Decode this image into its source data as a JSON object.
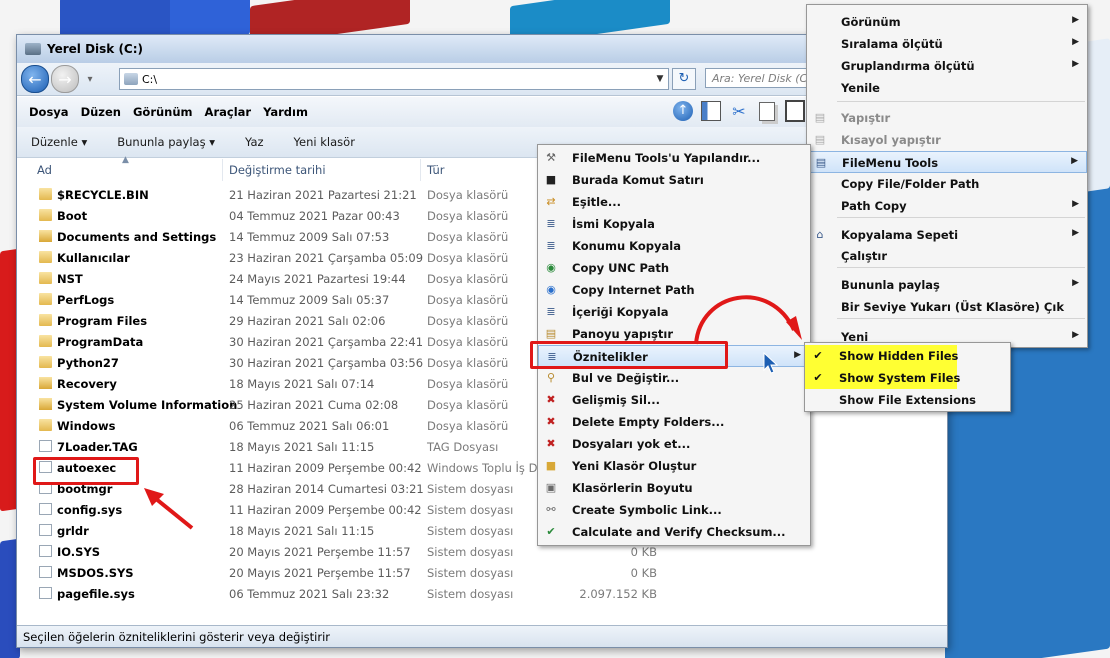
{
  "window": {
    "title": "Yerel Disk (C:)"
  },
  "address": {
    "path": "C:\\",
    "search_placeholder": "Ara: Yerel Disk (C:)"
  },
  "menubar": [
    "Dosya",
    "Düzen",
    "Görünüm",
    "Araçlar",
    "Yardım"
  ],
  "commandbar": [
    "Düzenle ▾",
    "Bununla paylaş ▾",
    "Yaz",
    "Yeni klasör"
  ],
  "columns": {
    "name": "Ad",
    "date": "Değiştirme tarihi",
    "type": "Tür"
  },
  "files": [
    {
      "name": "$RECYCLE.BIN",
      "date": "21 Haziran 2021 Pazartesi 21:21",
      "type": "Dosya klasörü",
      "size": "",
      "kind": "folder"
    },
    {
      "name": "Boot",
      "date": "04 Temmuz 2021 Pazar 00:43",
      "type": "Dosya klasörü",
      "size": "",
      "kind": "folder"
    },
    {
      "name": "Documents and Settings",
      "date": "14 Temmuz 2009 Salı 07:53",
      "type": "Dosya klasörü",
      "size": "",
      "kind": "lock"
    },
    {
      "name": "Kullanıcılar",
      "date": "23 Haziran 2021 Çarşamba 05:09",
      "type": "Dosya klasörü",
      "size": "",
      "kind": "folder"
    },
    {
      "name": "NST",
      "date": "24 Mayıs 2021 Pazartesi 19:44",
      "type": "Dosya klasörü",
      "size": "",
      "kind": "folder"
    },
    {
      "name": "PerfLogs",
      "date": "14 Temmuz 2009 Salı 05:37",
      "type": "Dosya klasörü",
      "size": "",
      "kind": "folder"
    },
    {
      "name": "Program Files",
      "date": "29 Haziran 2021 Salı 02:06",
      "type": "Dosya klasörü",
      "size": "",
      "kind": "folder"
    },
    {
      "name": "ProgramData",
      "date": "30 Haziran 2021 Çarşamba 22:41",
      "type": "Dosya klasörü",
      "size": "",
      "kind": "folder"
    },
    {
      "name": "Python27",
      "date": "30 Haziran 2021 Çarşamba 03:56",
      "type": "Dosya klasörü",
      "size": "",
      "kind": "folder"
    },
    {
      "name": "Recovery",
      "date": "18 Mayıs 2021 Salı 07:14",
      "type": "Dosya klasörü",
      "size": "",
      "kind": "lock"
    },
    {
      "name": "System Volume Information",
      "date": "25 Haziran 2021 Cuma 02:08",
      "type": "Dosya klasörü",
      "size": "",
      "kind": "lock"
    },
    {
      "name": "Windows",
      "date": "06 Temmuz 2021 Salı 06:01",
      "type": "Dosya klasörü",
      "size": "",
      "kind": "folder"
    },
    {
      "name": "7Loader.TAG",
      "date": "18 Mayıs 2021 Salı 11:15",
      "type": "TAG Dosyası",
      "size": "",
      "kind": "file"
    },
    {
      "name": "autoexec",
      "date": "11 Haziran 2009 Perşembe 00:42",
      "type": "Windows Toplu İş D",
      "size": "",
      "kind": "file"
    },
    {
      "name": "bootmgr",
      "date": "28 Haziran 2014 Cumartesi 03:21",
      "type": "Sistem dosyası",
      "size": "",
      "kind": "file"
    },
    {
      "name": "config.sys",
      "date": "11 Haziran 2009 Perşembe 00:42",
      "type": "Sistem dosyası",
      "size": "",
      "kind": "file"
    },
    {
      "name": "grldr",
      "date": "18 Mayıs 2021 Salı 11:15",
      "type": "Sistem dosyası",
      "size": "",
      "kind": "file"
    },
    {
      "name": "IO.SYS",
      "date": "20 Mayıs 2021 Perşembe 11:57",
      "type": "Sistem dosyası",
      "size": "0 KB",
      "kind": "file"
    },
    {
      "name": "MSDOS.SYS",
      "date": "20 Mayıs 2021 Perşembe 11:57",
      "type": "Sistem dosyası",
      "size": "0 KB",
      "kind": "file"
    },
    {
      "name": "pagefile.sys",
      "date": "06 Temmuz 2021 Salı 23:32",
      "type": "Sistem dosyası",
      "size": "2.097.152 KB",
      "kind": "file"
    }
  ],
  "status": "Seçilen öğelerin özniteliklerini gösterir veya değiştirir",
  "main_menu": [
    {
      "label": "Görünüm",
      "arrow": true,
      "disabled": false
    },
    {
      "label": "Sıralama ölçütü",
      "arrow": true,
      "disabled": false
    },
    {
      "label": "Gruplandırma ölçütü",
      "arrow": true,
      "disabled": false
    },
    {
      "label": "Yenile",
      "arrow": false,
      "disabled": false
    },
    {
      "label": "Yapıştır",
      "arrow": false,
      "disabled": true
    },
    {
      "label": "Kısayol yapıştır",
      "arrow": false,
      "disabled": true
    },
    {
      "label": "FileMenu Tools",
      "arrow": true,
      "disabled": false
    },
    {
      "label": "Copy File/Folder Path",
      "arrow": false,
      "disabled": false
    },
    {
      "label": "Path Copy",
      "arrow": true,
      "disabled": false
    },
    {
      "label": "Kopyalama Sepeti",
      "arrow": true,
      "disabled": false
    },
    {
      "label": "Çalıştır",
      "arrow": false,
      "disabled": false
    },
    {
      "label": "Bununla paylaş",
      "arrow": true,
      "disabled": false
    },
    {
      "label": "Bir Seviye Yukarı (Üst Klasöre) Çık",
      "arrow": false,
      "disabled": false
    },
    {
      "label": "Yeni",
      "arrow": true,
      "disabled": false
    }
  ],
  "filemenu": [
    "FileMenu Tools'u Yapılandır...",
    "Burada Komut Satırı",
    "Eşitle...",
    "İsmi Kopyala",
    "Konumu Kopyala",
    "Copy UNC Path",
    "Copy Internet Path",
    "İçeriği Kopyala",
    "Panoyu yapıştır",
    "Öznitelikler",
    "Bul ve Değiştir...",
    "Gelişmiş Sil...",
    "Delete Empty Folders...",
    "Dosyaları yok et...",
    "Yeni Klasör Oluştur",
    "Klasörlerin Boyutu",
    "Create Symbolic Link...",
    "Calculate and Verify Checksum..."
  ],
  "attr_menu": [
    {
      "label": "Show Hidden Files",
      "checked": true
    },
    {
      "label": "Show System Files",
      "checked": true
    },
    {
      "label": "Show File Extensions",
      "checked": false
    }
  ],
  "colors": {
    "highlight": "#ffff33",
    "annotation": "#e01818",
    "accent": "#1d5fb3"
  }
}
